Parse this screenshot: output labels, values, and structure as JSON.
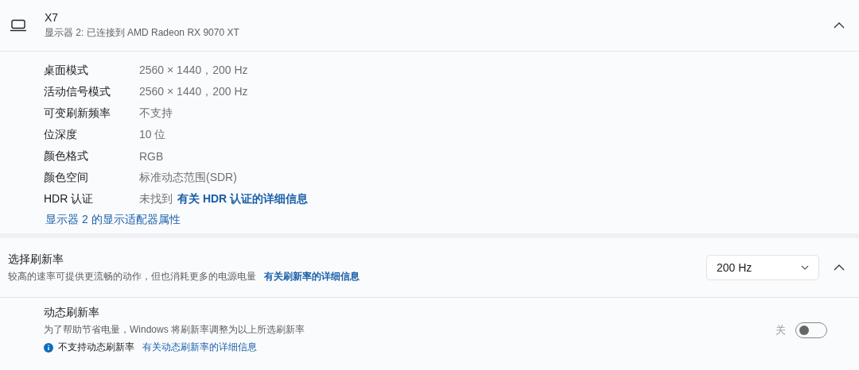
{
  "display": {
    "name": "X7",
    "subtitle": "显示器 2: 已连接到 AMD Radeon RX 9070 XT",
    "expanded": true
  },
  "details": [
    {
      "label": "桌面模式",
      "value": "2560 × 1440，200 Hz"
    },
    {
      "label": "活动信号模式",
      "value": "2560 × 1440，200 Hz"
    },
    {
      "label": "可变刷新频率",
      "value": "不支持"
    },
    {
      "label": "位深度",
      "value": "10 位"
    },
    {
      "label": "颜色格式",
      "value": "RGB"
    },
    {
      "label": "颜色空间",
      "value": "标准动态范围(SDR)"
    },
    {
      "label": "HDR 认证",
      "value": "未找到",
      "link": "有关 HDR 认证的详细信息"
    }
  ],
  "adapter_link": "显示器 2 的显示适配器属性",
  "refresh_rate": {
    "title": "选择刷新率",
    "description": "较高的速率可提供更流畅的动作，但也消耗更多的电源电量",
    "link": "有关刷新率的详细信息",
    "dropdown": "200 Hz",
    "expanded": true
  },
  "dynamic_refresh": {
    "title": "动态刷新率",
    "description": "为了帮助节省电量，Windows 将刷新率调整为以上所选刷新率",
    "notice": "不支持动态刷新率",
    "link": "有关动态刷新率的详细信息",
    "toggle_label": "关",
    "on": false
  }
}
